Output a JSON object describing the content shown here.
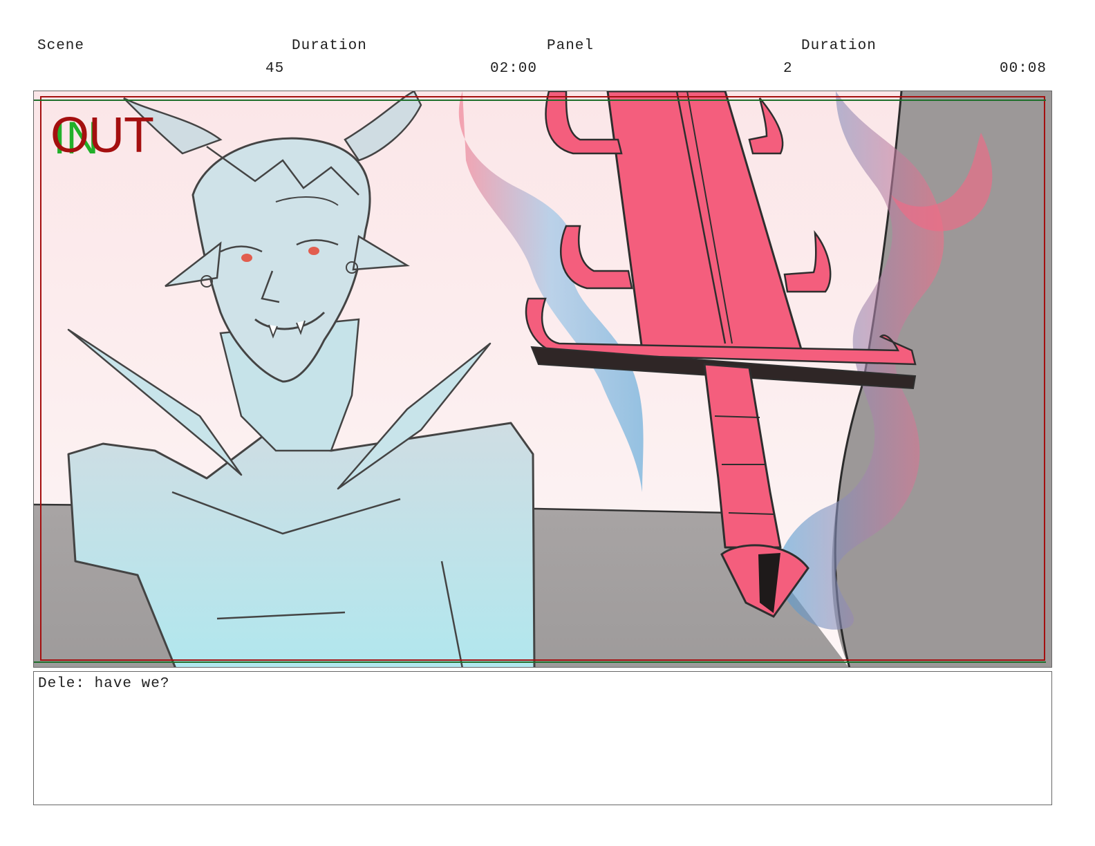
{
  "header": {
    "scene_label": "Scene",
    "scene_duration_label": "Duration",
    "panel_label": "Panel",
    "panel_duration_label": "Duration",
    "scene_number": "45",
    "scene_duration": "02:00",
    "panel_number": "2",
    "panel_duration": "00:08"
  },
  "panel": {
    "in_marker": "IN",
    "out_marker": "OUT"
  },
  "notes": {
    "dialogue": "Dele: have we?"
  }
}
